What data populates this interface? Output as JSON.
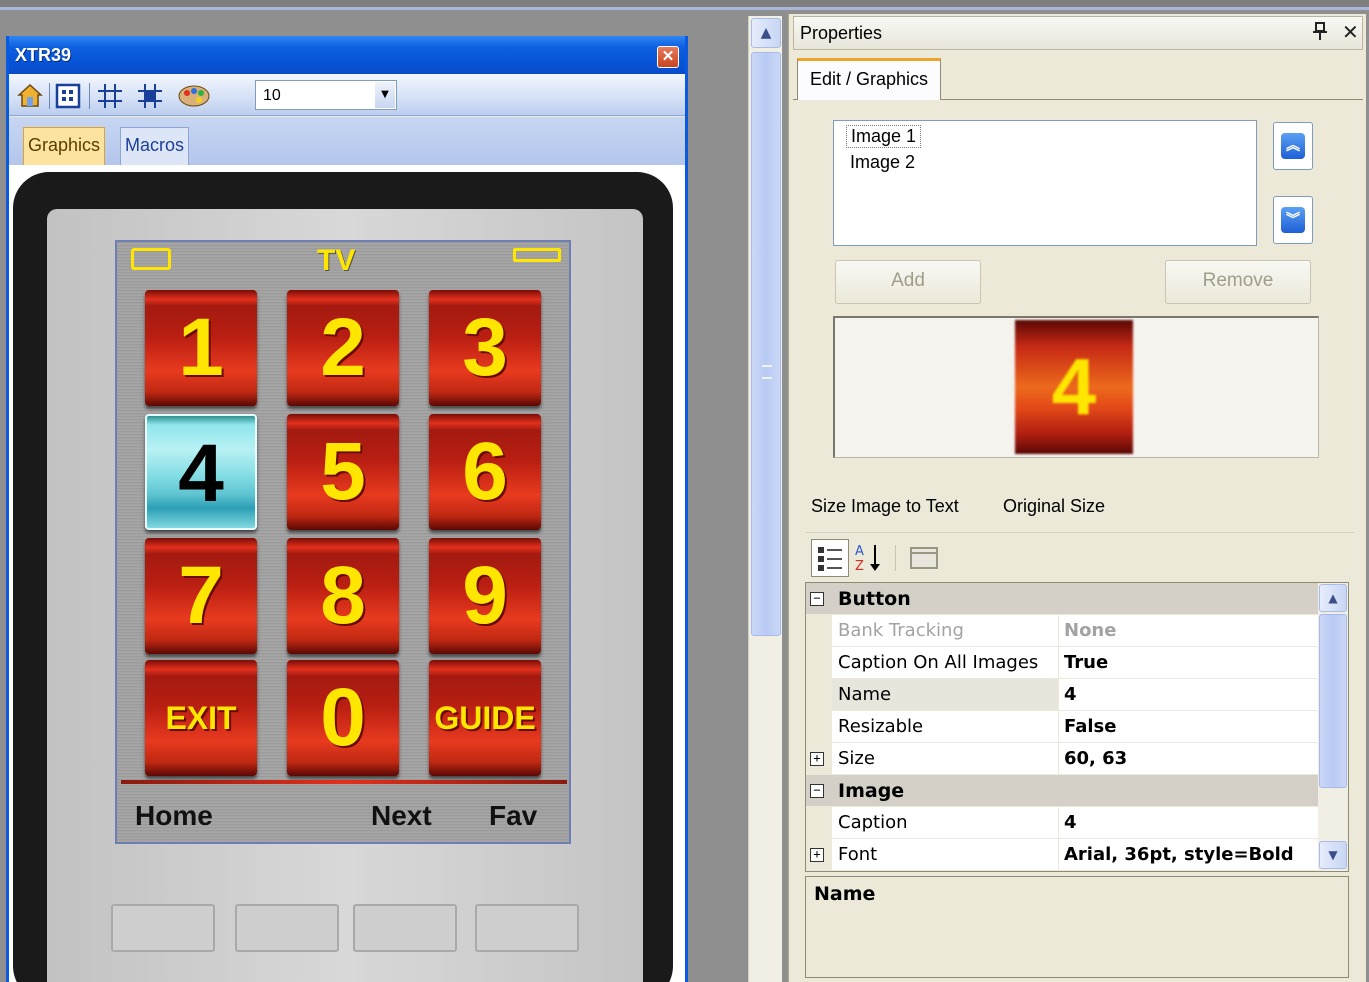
{
  "window": {
    "title": "XTR39",
    "close_glyph": "✕",
    "zoom_value": "10",
    "tabs": [
      "Graphics",
      "Macros"
    ]
  },
  "remote": {
    "screen_title": "TV",
    "keys": [
      "1",
      "2",
      "3",
      "4",
      "5",
      "6",
      "7",
      "8",
      "9",
      "EXIT",
      "0",
      "GUIDE"
    ],
    "selected_key": "4",
    "softkeys": [
      "Home",
      "Next",
      "Fav"
    ]
  },
  "properties": {
    "title": "Properties",
    "pin_glyph": "ᵖ",
    "close_glyph": "✕",
    "tab": "Edit / Graphics",
    "images": [
      "Image 1",
      "Image 2"
    ],
    "add_label": "Add",
    "remove_label": "Remove",
    "preview_caption": "4",
    "commands": [
      "Size Image to Text",
      "Original Size"
    ],
    "grid": {
      "button_category": "Button",
      "image_category": "Image",
      "rows": {
        "bank_tracking": {
          "name": "Bank Tracking",
          "value": "None"
        },
        "caption_all": {
          "name": "Caption On All Images",
          "value": "True"
        },
        "name": {
          "name": "Name",
          "value": "4"
        },
        "resizable": {
          "name": "Resizable",
          "value": "False"
        },
        "size": {
          "name": "Size",
          "value": "60, 63"
        },
        "caption": {
          "name": "Caption",
          "value": "4"
        },
        "font": {
          "name": "Font",
          "value": "Arial, 36pt, style=Bold"
        }
      }
    },
    "description_title": "Name"
  },
  "colors": {
    "xp_title_blue": "#0653d8",
    "key_red": "#c02812",
    "key_text_yellow": "#ffe600",
    "selected_key_cyan": "#8fe6ec"
  }
}
